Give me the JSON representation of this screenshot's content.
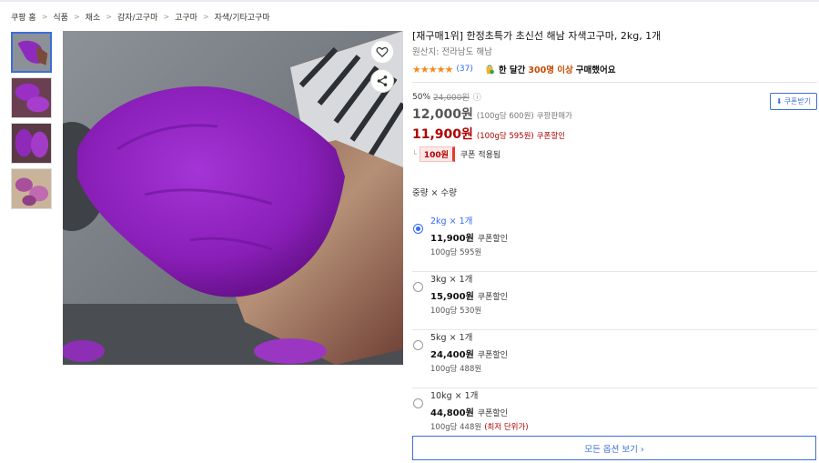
{
  "breadcrumb": [
    "쿠팡 홈",
    "식품",
    "채소",
    "감자/고구마",
    "고구마",
    "자색/기타고구마"
  ],
  "breadcrumb_separator": ">",
  "product": {
    "title": "[재구매1위] 한정초특가 초신선 해남 자색고구마, 2kg, 1개",
    "origin": "원산지: 전라남도 해남",
    "review_count": "(37)",
    "rating_stars": 5,
    "purchase_prefix": "한 달간",
    "purchase_count": "300명 이상",
    "purchase_suffix": "구매했어요"
  },
  "price": {
    "discount_rate": "50%",
    "original_price": "24,000원",
    "info_icon": "ⓘ",
    "sale_price": "12,000원",
    "sale_unit": "(100g당 600원)",
    "sale_label": "쿠팡판매가",
    "coupon_price": "11,900원",
    "coupon_unit": "(100g당 595원)",
    "coupon_label": "쿠폰할인",
    "coupon_amount": "100원",
    "coupon_applied": "쿠폰 적용됨",
    "coupon_button": "쿠폰받기"
  },
  "options_header": "중량 × 수량",
  "options": [
    {
      "name": "2kg × 1개",
      "price": "11,900원",
      "coupon": "쿠폰할인",
      "unit": "100g당 595원",
      "lowest": "",
      "selected": true
    },
    {
      "name": "3kg × 1개",
      "price": "15,900원",
      "coupon": "쿠폰할인",
      "unit": "100g당 530원",
      "lowest": "",
      "selected": false
    },
    {
      "name": "5kg × 1개",
      "price": "24,400원",
      "coupon": "쿠폰할인",
      "unit": "100g당 488원",
      "lowest": "",
      "selected": false
    },
    {
      "name": "10kg × 1개",
      "price": "44,800원",
      "coupon": "쿠폰할인",
      "unit": "100g당 448원",
      "lowest": "(최저 단위가)",
      "selected": false
    }
  ],
  "all_options_button": "모든 옵션 보기 ›",
  "colors": {
    "accent_blue": "#346aff",
    "coupon_red": "#ae0000",
    "star_orange": "#f58a1f",
    "purple_flesh": "#8a1fb8"
  },
  "icons": [
    "heart-icon",
    "share-icon",
    "bag-icon",
    "download-icon",
    "info-icon"
  ]
}
